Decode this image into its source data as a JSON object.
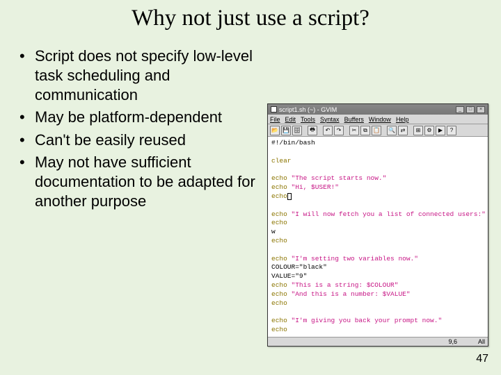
{
  "title": "Why not just use a script?",
  "bullets": [
    "Script does not specify low-level task scheduling and communication",
    "May be platform-dependent",
    "Can't be easily reused",
    "May not have sufficient documentation to be adapted for another purpose"
  ],
  "page_number": "47",
  "editor": {
    "window_title": "script1.sh (~) - GVIM",
    "menu": [
      "File",
      "Edit",
      "Tools",
      "Syntax",
      "Buffers",
      "Window",
      "Help"
    ],
    "toolbar_icons": [
      "open-icon",
      "save-icon",
      "save-all-icon",
      "print-icon",
      "undo-icon",
      "redo-icon",
      "cut-icon",
      "copy-icon",
      "paste-icon",
      "find-icon",
      "replace-icon",
      "tag-icon",
      "make-icon",
      "shell-icon",
      "help-icon"
    ],
    "code": {
      "l1": "#!/bin/bash",
      "l2": "",
      "l3": "clear",
      "l4": "",
      "l5a": "echo",
      "l5b": "\"The script starts now.\"",
      "l6a": "echo",
      "l6b": "\"Hi, $USER!\"",
      "l7": "echo",
      "l8": "",
      "l9a": "echo",
      "l9b": "\"I will now fetch you a list of connected users:\"",
      "l10": "echo",
      "l11": "w",
      "l12": "echo",
      "l13": "",
      "l14a": "echo",
      "l14b": "\"I'm setting two variables now.\"",
      "l15": "COLOUR=\"black\"",
      "l16": "VALUE=\"9\"",
      "l17a": "echo",
      "l17b": "\"This is a string: $COLOUR\"",
      "l18a": "echo",
      "l18b": "\"And this is a number: $VALUE\"",
      "l19": "echo",
      "l20": "",
      "l21a": "echo",
      "l21b": "\"I'm giving you back your prompt now.\"",
      "l22": "echo"
    },
    "status_left": "",
    "status_mid": "9,6",
    "status_right": "All"
  }
}
